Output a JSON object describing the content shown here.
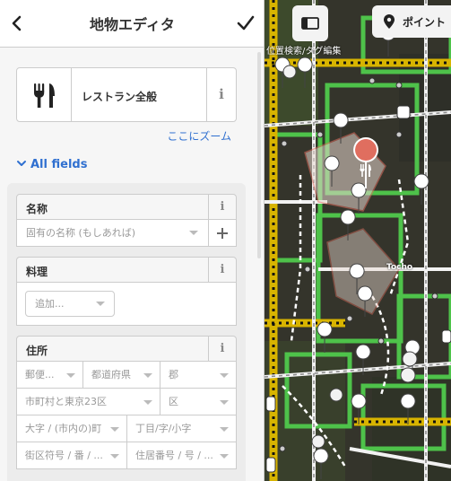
{
  "header": {
    "title": "地物エディタ"
  },
  "preset": {
    "name": "レストラン全般"
  },
  "zoom_link": "ここにズーム",
  "all_fields": "All fields",
  "fields": {
    "name": {
      "label": "名称",
      "placeholder": "固有の名称 (もしあれば)"
    },
    "cuisine": {
      "label": "料理",
      "add_placeholder": "追加..."
    },
    "address": {
      "label": "住所",
      "postcode": "郵便...",
      "prefecture": "都道府県",
      "county": "郡",
      "city": "市町村と東京23区",
      "ward": "区",
      "quarter": "大字 / (市内の)町",
      "neighbourhood": "丁目/字/小字",
      "block": "街区符号 / 番 / ...",
      "housenumber": "住居番号 / 号 / ..."
    }
  },
  "map": {
    "point_label": "ポイント",
    "message": "位置検索/タグ編集",
    "place_label": "Tocho"
  },
  "colors": {
    "accent": "#3070d0",
    "selected_pin": "#e06e5f",
    "highlight": "#e8d9d0"
  }
}
